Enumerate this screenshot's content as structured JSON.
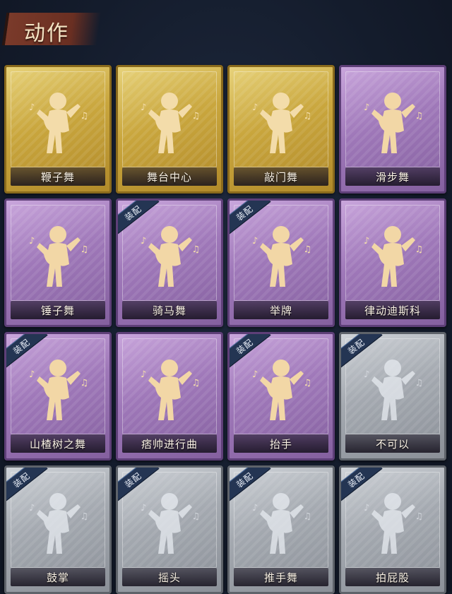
{
  "header": {
    "title": "动作"
  },
  "equip_label": "装配",
  "colors": {
    "gold": "#c9a63d",
    "purple": "#9f78b9",
    "grey": "#a4a9b0",
    "equip": "#243553"
  },
  "cards": [
    {
      "label": "鞭子舞",
      "rarity": "gold",
      "equipped": false,
      "icon": "dancer-whip-icon"
    },
    {
      "label": "舞台中心",
      "rarity": "gold",
      "equipped": false,
      "icon": "dancer-pose-icon"
    },
    {
      "label": "敲门舞",
      "rarity": "gold",
      "equipped": false,
      "icon": "dancer-knock-icon"
    },
    {
      "label": "滑步舞",
      "rarity": "purple",
      "equipped": false,
      "icon": "dancer-slide-icon"
    },
    {
      "label": "锤子舞",
      "rarity": "purple",
      "equipped": false,
      "icon": "dancer-hammer-icon"
    },
    {
      "label": "骑马舞",
      "rarity": "purple",
      "equipped": true,
      "icon": "dancer-horse-icon"
    },
    {
      "label": "举牌",
      "rarity": "purple",
      "equipped": true,
      "icon": "sign-hold-icon"
    },
    {
      "label": "律动迪斯科",
      "rarity": "purple",
      "equipped": false,
      "icon": "dancer-disco-icon"
    },
    {
      "label": "山楂树之舞",
      "rarity": "purple",
      "equipped": true,
      "icon": "dancer-hawthorn-icon"
    },
    {
      "label": "痞帅进行曲",
      "rarity": "purple",
      "equipped": false,
      "icon": "dancer-march-icon"
    },
    {
      "label": "抬手",
      "rarity": "purple",
      "equipped": true,
      "icon": "raise-hand-icon"
    },
    {
      "label": "不可以",
      "rarity": "grey",
      "equipped": true,
      "icon": "finger-wag-icon"
    },
    {
      "label": "鼓掌",
      "rarity": "grey",
      "equipped": true,
      "icon": "clap-icon"
    },
    {
      "label": "摇头",
      "rarity": "grey",
      "equipped": true,
      "icon": "head-shake-icon"
    },
    {
      "label": "推手舞",
      "rarity": "grey",
      "equipped": true,
      "icon": "push-hands-icon"
    },
    {
      "label": "拍屁股",
      "rarity": "grey",
      "equipped": true,
      "icon": "butt-slap-icon"
    }
  ]
}
